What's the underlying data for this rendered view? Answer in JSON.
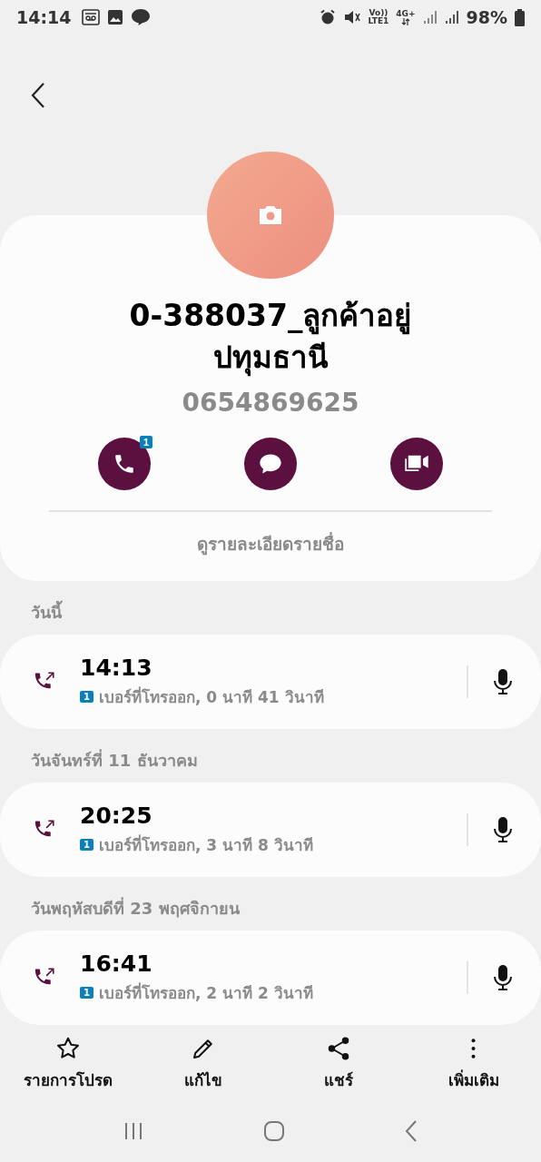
{
  "status_bar": {
    "time": "14:14",
    "volte": "Vo))",
    "lte": "LTE1",
    "data": "4G+",
    "battery": "98%"
  },
  "contact": {
    "name": "0-388037_ลูกค้าอยู่ปทุมธานี",
    "number": "0654869625",
    "details_link": "ดูรายละเอียดรายชื่อ"
  },
  "actions": [
    {
      "kind": "call",
      "badge": "1"
    },
    {
      "kind": "message"
    },
    {
      "kind": "video"
    }
  ],
  "call_log": [
    {
      "date": "วันนี้",
      "calls": [
        {
          "time": "14:13",
          "sim": "1",
          "detail": "เบอร์ที่โทรออก, 0 นาที 41 วินาที"
        }
      ]
    },
    {
      "date": "วันจันทร์ที่ 11 ธันวาคม",
      "calls": [
        {
          "time": "20:25",
          "sim": "1",
          "detail": "เบอร์ที่โทรออก, 3 นาที 8 วินาที"
        }
      ]
    },
    {
      "date": "วันพฤหัสบดีที่ 23 พฤศจิกายน",
      "calls": [
        {
          "time": "16:41",
          "sim": "1",
          "detail": "เบอร์ที่โทรออก, 2 นาที 2 วินาที"
        }
      ]
    }
  ],
  "bottom_bar": [
    {
      "kind": "star",
      "label": "รายการโปรด"
    },
    {
      "kind": "edit",
      "label": "แก้ไข"
    },
    {
      "kind": "share",
      "label": "แชร์"
    },
    {
      "kind": "more",
      "label": "เพิ่มเติม"
    }
  ]
}
